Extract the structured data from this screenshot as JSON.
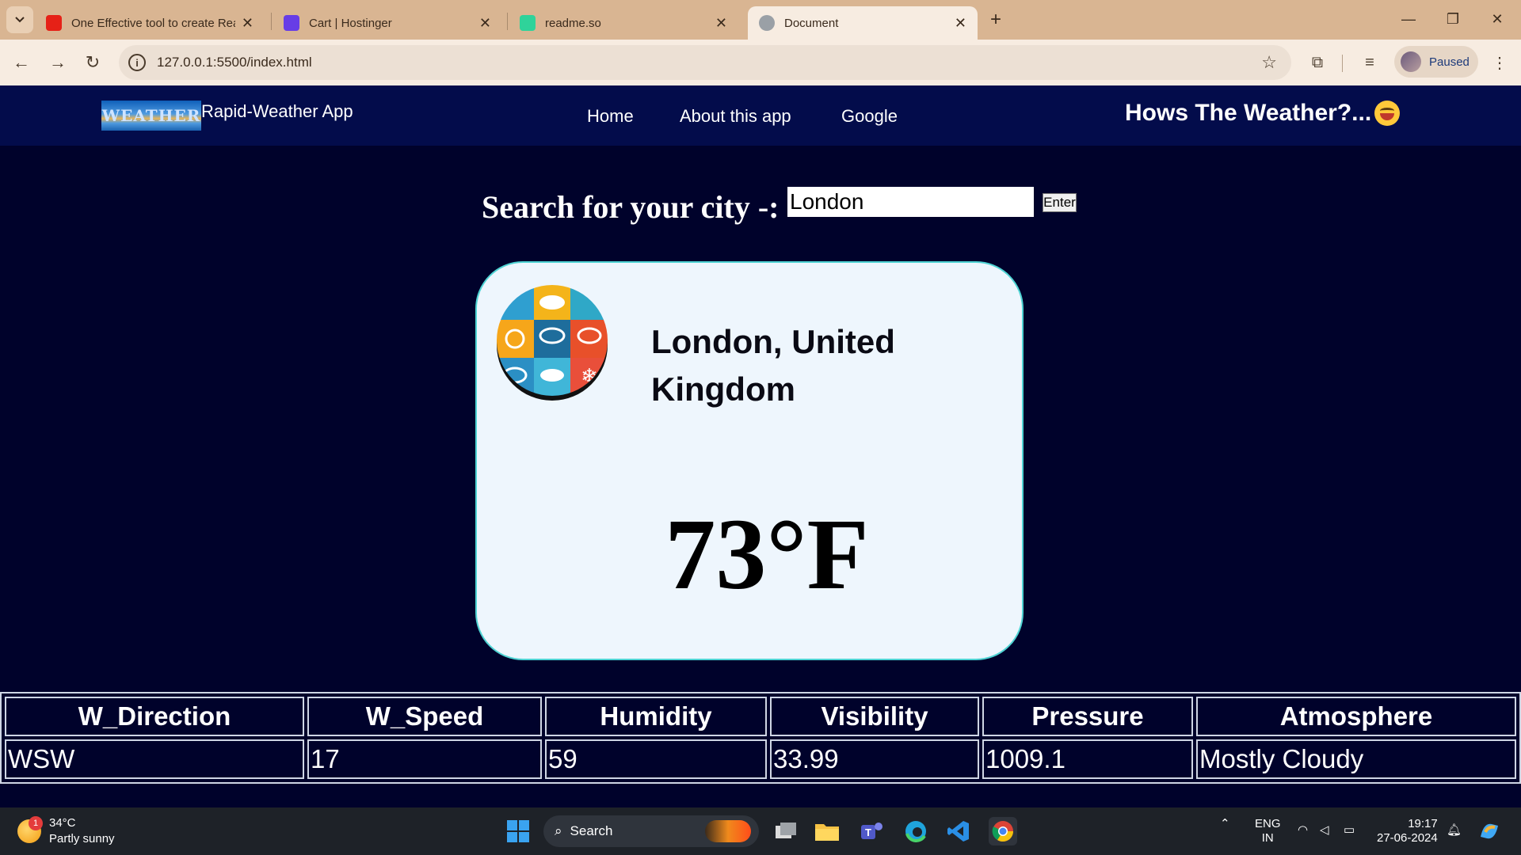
{
  "browser": {
    "tabs": [
      {
        "title": "One Effective tool to create Rea",
        "favicon_color": "#e62117",
        "active": false
      },
      {
        "title": "Cart | Hostinger",
        "favicon_color": "#673de6",
        "active": false
      },
      {
        "title": "readme.so",
        "favicon_color": "#2fd39a",
        "active": false
      },
      {
        "title": "Document",
        "favicon_color": "#9aa0a6",
        "active": true
      }
    ],
    "url": "127.0.0.1:5500/index.html",
    "profile_label": "Paused"
  },
  "navbar": {
    "logo_text": "WEATHER",
    "brand": "Rapid-Weather App",
    "links": [
      "Home",
      "About this app",
      "Google"
    ],
    "tagline": "Hows The Weather?..."
  },
  "search": {
    "label": "Search for your city -:",
    "value": "London",
    "button": "Enter"
  },
  "card": {
    "city": "London, United Kingdom",
    "temperature": "73°F"
  },
  "table": {
    "headers": [
      "W_Direction",
      "W_Speed",
      "Humidity",
      "Visibility",
      "Pressure",
      "Atmosphere"
    ],
    "row": [
      "WSW",
      "17",
      "59",
      "33.99",
      "1009.1",
      "Mostly Cloudy"
    ]
  },
  "taskbar": {
    "weather_temp": "34°C",
    "weather_desc": "Partly sunny",
    "weather_badge": "1",
    "search_label": "Search",
    "lang_top": "ENG",
    "lang_bottom": "IN",
    "time": "19:17",
    "date": "27-06-2024"
  },
  "colors": {
    "page_bg": "#00022b",
    "navbar_bg": "#030c4b",
    "card_bg": "#eef6fd",
    "card_border": "#4ed3d3"
  }
}
